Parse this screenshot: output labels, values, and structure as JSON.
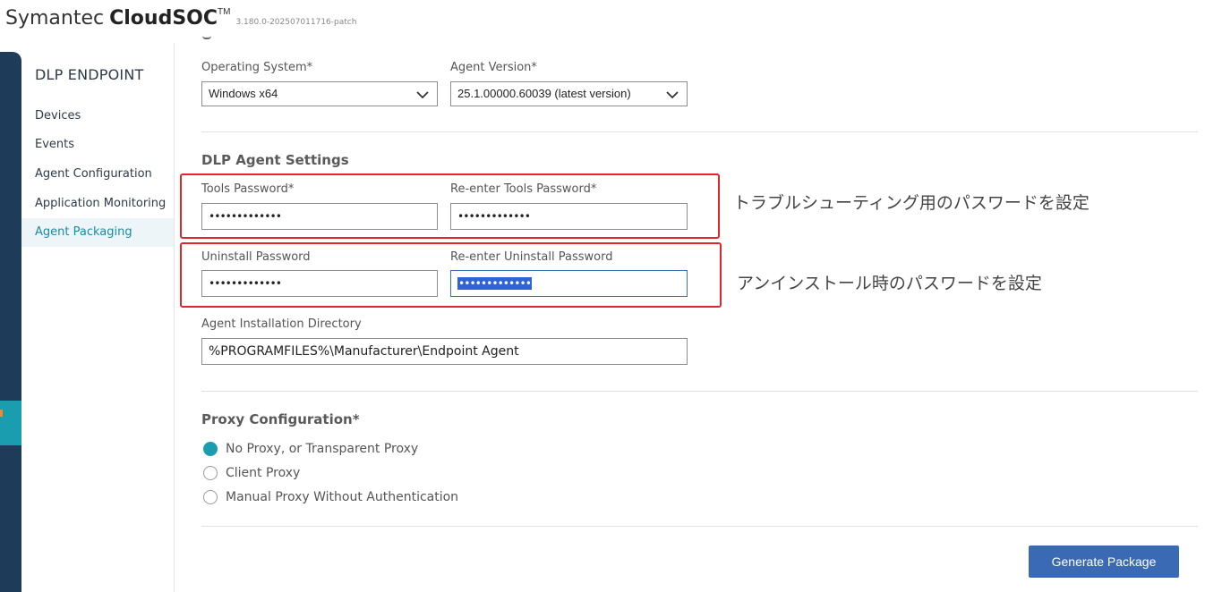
{
  "header": {
    "brand_prefix": "Symantec",
    "brand_product": "CloudSOC",
    "brand_tm": "TM",
    "version": "3.180.0-202507011716-patch"
  },
  "sidebar": {
    "title": "DLP ENDPOINT",
    "items": [
      {
        "label": "Devices",
        "active": false
      },
      {
        "label": "Events",
        "active": false
      },
      {
        "label": "Agent Configuration",
        "active": false
      },
      {
        "label": "Application Monitoring",
        "active": false
      },
      {
        "label": "Agent Packaging",
        "active": true
      }
    ]
  },
  "form": {
    "os_label": "Operating System*",
    "os_value": "Windows x64",
    "agent_version_label": "Agent Version*",
    "agent_version_value": "25.1.00000.60039 (latest version)",
    "dlp_section_title": "DLP Agent Settings",
    "tools_pw_label": "Tools Password*",
    "tools_pw_value": "•••••••••••••",
    "tools_pw_reenter_label": "Re-enter Tools Password*",
    "tools_pw_reenter_value": "•••••••••••••",
    "uninstall_pw_label": "Uninstall Password",
    "uninstall_pw_value": "•••••••••••••",
    "uninstall_pw_reenter_label": "Re-enter Uninstall Password",
    "uninstall_pw_reenter_value": "•••••••••••••",
    "install_dir_label": "Agent Installation Directory",
    "install_dir_value": "%PROGRAMFILES%\\Manufacturer\\Endpoint Agent",
    "proxy_section_title": "Proxy Configuration*",
    "proxy_options": [
      {
        "label": "No Proxy, or Transparent Proxy",
        "checked": true
      },
      {
        "label": "Client Proxy",
        "checked": false
      },
      {
        "label": "Manual Proxy Without Authentication",
        "checked": false
      }
    ],
    "generate_button": "Generate Package"
  },
  "annotations": {
    "tools_note": "トラブルシューティング用のパスワードを設定",
    "uninstall_note": "アンインストール時のパスワードを設定",
    "box_color": "#e0262b"
  },
  "colors": {
    "accent": "#1b9db0",
    "rail": "#1f3b5a",
    "button": "#3a6ab3"
  }
}
